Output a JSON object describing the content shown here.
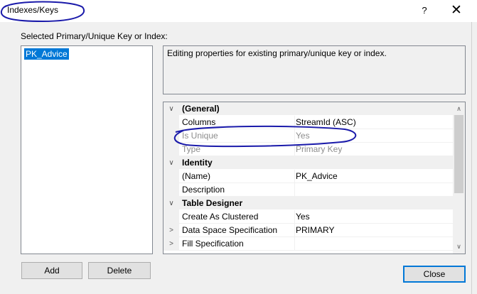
{
  "window": {
    "title": "Indexes/Keys",
    "help_glyph": "?",
    "close_glyph": "✕"
  },
  "left_panel": {
    "label": "Selected Primary/Unique Key or Index:",
    "items": [
      {
        "label": "PK_Advice",
        "selected": true
      }
    ]
  },
  "description": "Editing properties for existing primary/unique key or index.",
  "property_grid": {
    "rows": [
      {
        "kind": "category",
        "toggle": "∨",
        "name": "(General)"
      },
      {
        "kind": "prop",
        "name": "Columns",
        "value": "StreamId (ASC)"
      },
      {
        "kind": "prop",
        "name": "Is Unique",
        "value": "Yes",
        "disabled": true
      },
      {
        "kind": "prop",
        "name": "Type",
        "value": "Primary Key",
        "disabled": true
      },
      {
        "kind": "category",
        "toggle": "∨",
        "name": "Identity"
      },
      {
        "kind": "prop",
        "name": "(Name)",
        "value": "PK_Advice"
      },
      {
        "kind": "prop",
        "name": "Description",
        "value": ""
      },
      {
        "kind": "category",
        "toggle": "∨",
        "name": "Table Designer"
      },
      {
        "kind": "prop",
        "name": "Create As Clustered",
        "value": "Yes"
      },
      {
        "kind": "prop",
        "toggle": ">",
        "name": "Data Space Specification",
        "value": "PRIMARY"
      },
      {
        "kind": "prop",
        "toggle": ">",
        "name": "Fill Specification",
        "value": ""
      }
    ],
    "scroll_up_glyph": "∧",
    "scroll_down_glyph": "∨"
  },
  "buttons": {
    "add": "Add",
    "delete": "Delete",
    "close": "Close"
  },
  "colors": {
    "selection": "#0078d7",
    "annotation": "#1a1aaa"
  }
}
